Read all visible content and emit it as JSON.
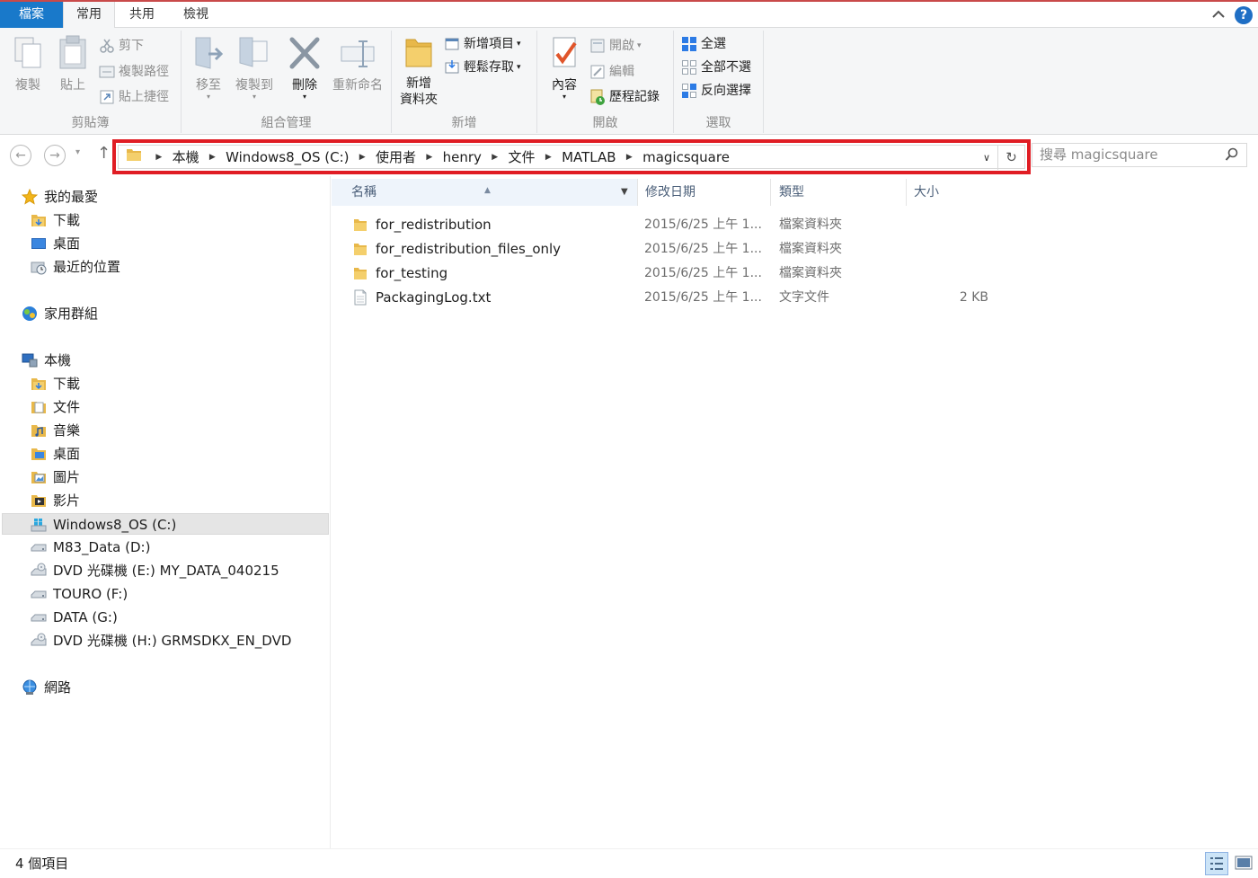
{
  "ribbon_tabs": {
    "file": "檔案",
    "home": "常用",
    "share": "共用",
    "view": "檢視"
  },
  "ribbon": {
    "clipboard": {
      "label": "剪貼簿",
      "copy": "複製",
      "paste": "貼上",
      "cut": "剪下",
      "copy_path": "複製路徑",
      "paste_shortcut": "貼上捷徑"
    },
    "organize": {
      "label": "組合管理",
      "move_to": "移至",
      "copy_to": "複製到",
      "delete": "刪除",
      "rename": "重新命名"
    },
    "new": {
      "label": "新增",
      "new_folder_line1": "新增",
      "new_folder_line2": "資料夾",
      "new_item": "新增項目",
      "easy_access": "輕鬆存取"
    },
    "open": {
      "label": "開啟",
      "properties": "內容",
      "open": "開啟",
      "edit": "編輯",
      "history": "歷程記錄"
    },
    "select": {
      "label": "選取",
      "select_all": "全選",
      "select_none": "全部不選",
      "invert": "反向選擇"
    }
  },
  "address": {
    "crumbs": [
      "本機",
      "Windows8_OS (C:)",
      "使用者",
      "henry",
      "文件",
      "MATLAB",
      "magicsquare"
    ]
  },
  "search": {
    "placeholder": "搜尋 magicsquare"
  },
  "navpane": {
    "favorites": "我的最愛",
    "fav_downloads": "下載",
    "fav_desktop": "桌面",
    "fav_recent": "最近的位置",
    "homegroup": "家用群組",
    "this_pc": "本機",
    "pc_downloads": "下載",
    "pc_documents": "文件",
    "pc_music": "音樂",
    "pc_desktop": "桌面",
    "pc_pictures": "圖片",
    "pc_videos": "影片",
    "drive_c": "Windows8_OS (C:)",
    "drive_d": "M83_Data (D:)",
    "drive_e": "DVD 光碟機 (E:) MY_DATA_040215",
    "drive_f": "TOURO (F:)",
    "drive_g": "DATA (G:)",
    "drive_h": "DVD 光碟機 (H:) GRMSDKX_EN_DVD",
    "network": "網路"
  },
  "columns": {
    "name": "名稱",
    "date": "修改日期",
    "type": "類型",
    "size": "大小"
  },
  "files": [
    {
      "name": "for_redistribution",
      "date": "2015/6/25 上午 1...",
      "type": "檔案資料夾",
      "size": ""
    },
    {
      "name": "for_redistribution_files_only",
      "date": "2015/6/25 上午 1...",
      "type": "檔案資料夾",
      "size": ""
    },
    {
      "name": "for_testing",
      "date": "2015/6/25 上午 1...",
      "type": "檔案資料夾",
      "size": ""
    },
    {
      "name": "PackagingLog.txt",
      "date": "2015/6/25 上午 1...",
      "type": "文字文件",
      "size": "2 KB"
    }
  ],
  "status": {
    "count": "4 個項目"
  },
  "colors": {
    "file_tab": "#1979ca",
    "highlight_box": "#e01d24",
    "folder": "#e8b84a"
  }
}
